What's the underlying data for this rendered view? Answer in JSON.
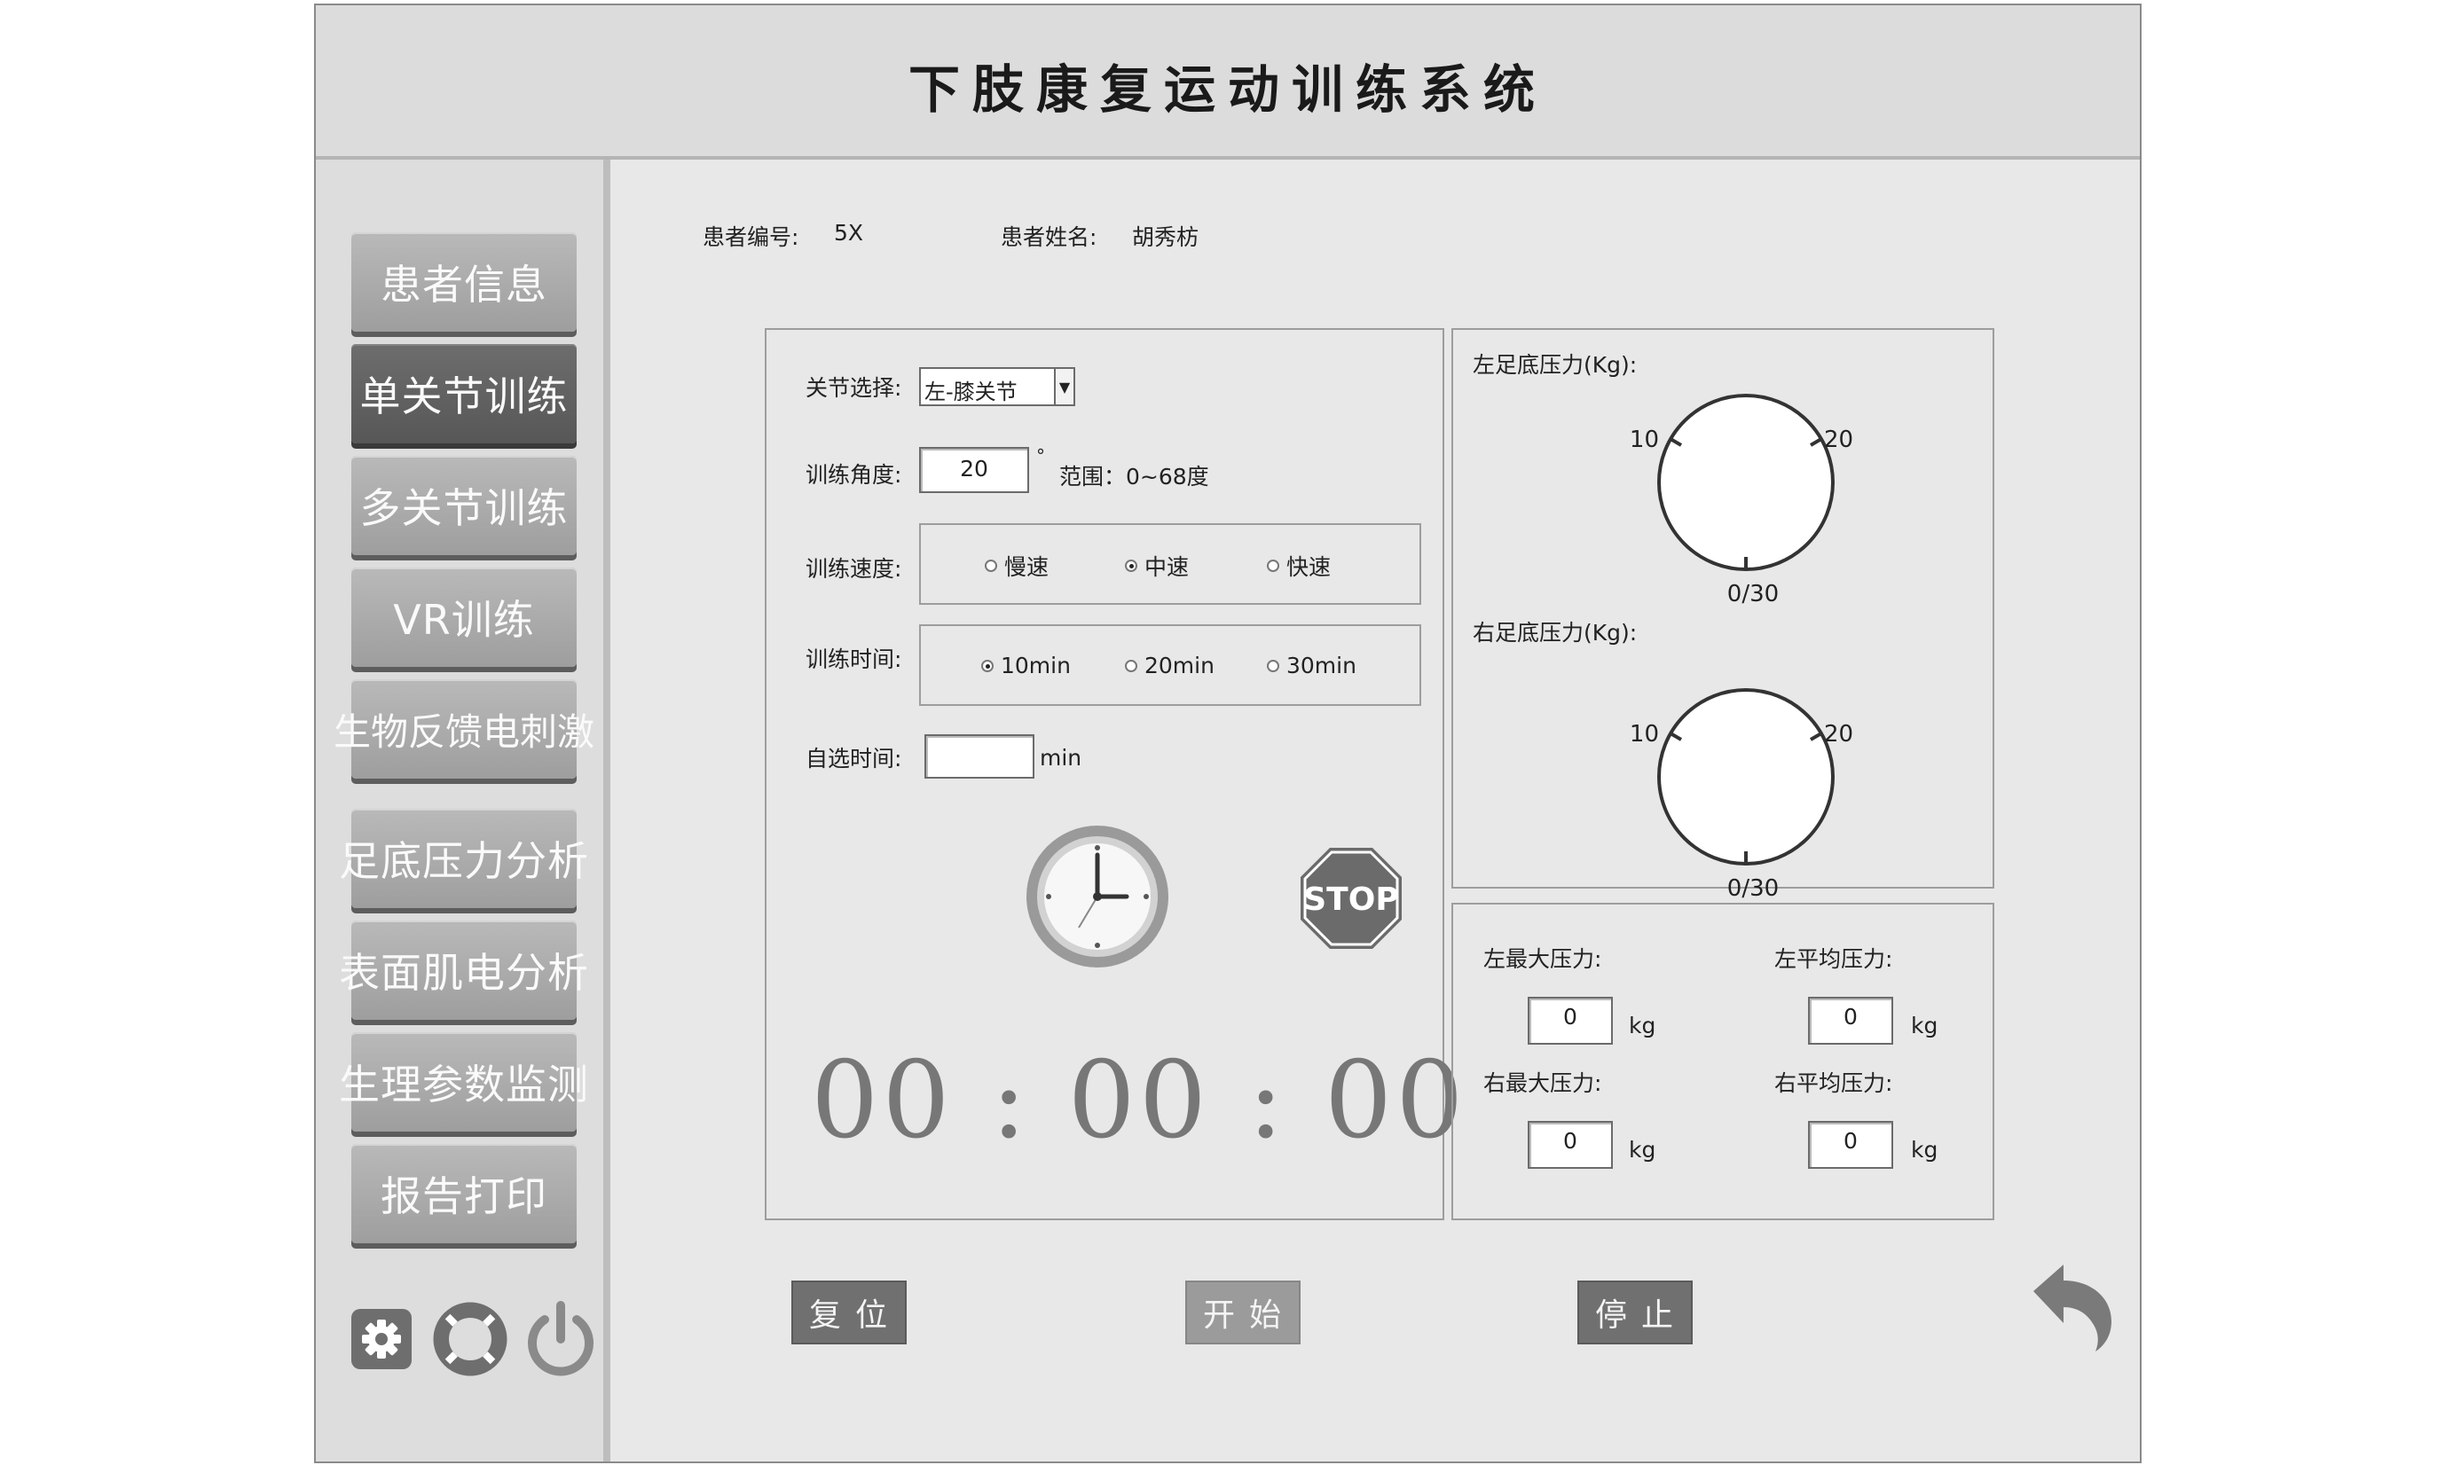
{
  "app": {
    "title": "下肢康复运动训练系统"
  },
  "sidebar": {
    "items": [
      {
        "label": "患者信息",
        "active": false
      },
      {
        "label": "单关节训练",
        "active": true
      },
      {
        "label": "多关节训练",
        "active": false
      },
      {
        "label": "VR训练",
        "active": false
      },
      {
        "label": "生物反馈电刺激",
        "active": false
      },
      {
        "label": "足底压力分析",
        "active": false
      },
      {
        "label": "表面肌电分析",
        "active": false
      },
      {
        "label": "生理参数监测",
        "active": false
      },
      {
        "label": "报告打印",
        "active": false
      }
    ],
    "icons": [
      "gear-icon",
      "lifebuoy-icon",
      "power-icon"
    ]
  },
  "patient": {
    "id_label": "患者编号:",
    "id_value": "5X",
    "name_label": "患者姓名:",
    "name_value": "胡秀枋"
  },
  "training": {
    "joint_label": "关节选择:",
    "joint_value": "左-膝关节",
    "angle_label": "训练角度:",
    "angle_value": "20",
    "angle_unit": "°",
    "angle_range": "范围：0~68度",
    "speed_label": "训练速度:",
    "speed_options": [
      {
        "label": "慢速",
        "selected": false
      },
      {
        "label": "中速",
        "selected": true
      },
      {
        "label": "快速",
        "selected": false
      }
    ],
    "time_label": "训练时间:",
    "time_options": [
      {
        "label": "10min",
        "selected": true
      },
      {
        "label": "20min",
        "selected": false
      },
      {
        "label": "30min",
        "selected": false
      }
    ],
    "custom_time_label": "自选时间:",
    "custom_time_value": "",
    "custom_time_unit": "min",
    "stop_sign_text": "STOP",
    "timer": {
      "h": "00",
      "m": "00",
      "s": "00",
      "sep": ":"
    }
  },
  "pressure": {
    "left_label": "左足底压力(Kg):",
    "right_label": "右足底压力(Kg):",
    "dial": {
      "tick_left": "10",
      "tick_right": "20",
      "tick_bottom": "0/30"
    },
    "left_max_label": "左最大压力:",
    "left_max_value": "0",
    "left_avg_label": "左平均压力:",
    "left_avg_value": "0",
    "right_max_label": "右最大压力:",
    "right_max_value": "0",
    "right_avg_label": "右平均压力:",
    "right_avg_value": "0",
    "unit": "kg"
  },
  "actions": {
    "reset": "复位",
    "start": "开始",
    "stop": "停止",
    "back_icon": "undo-arrow-icon"
  }
}
